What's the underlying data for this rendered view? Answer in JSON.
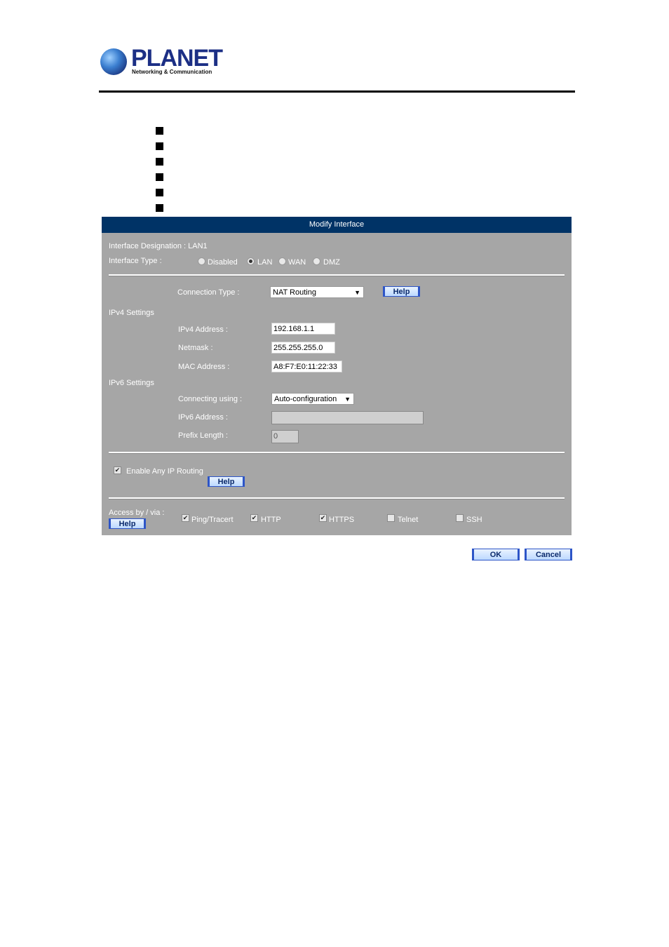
{
  "logo": {
    "brand": "PLANET",
    "tagline": "Networking & Communication"
  },
  "bullets_count": 6,
  "panel": {
    "title": "Modify Interface",
    "interface_designation_label": "Interface Designation : LAN1",
    "interface_type_label": "Interface Type :",
    "interface_type_options": [
      {
        "label": "Disabled",
        "selected": false
      },
      {
        "label": "LAN",
        "selected": true
      },
      {
        "label": "WAN",
        "selected": false
      },
      {
        "label": "DMZ",
        "selected": false
      }
    ],
    "connection_type_label": "Connection Type :",
    "connection_type_value": "NAT Routing",
    "help_label": "Help",
    "ipv4_section": "IPv4 Settings",
    "ipv4_address_label": "IPv4 Address :",
    "ipv4_address_value": "192.168.1.1",
    "netmask_label": "Netmask :",
    "netmask_value": "255.255.255.0",
    "mac_label": "MAC Address :",
    "mac_value": "A8:F7:E0:11:22:33",
    "ipv6_section": "IPv6 Settings",
    "connecting_using_label": "Connecting using :",
    "connecting_using_value": "Auto-configuration",
    "ipv6_address_label": "IPv6 Address :",
    "ipv6_address_value": "",
    "prefix_length_label": "Prefix Length :",
    "prefix_length_value": "0",
    "any_ip_routing_label": "Enable Any IP Routing",
    "any_ip_routing_checked": true,
    "access_label": "Access by / via :",
    "access_options": [
      {
        "label": "Ping/Tracert",
        "checked": true
      },
      {
        "label": "HTTP",
        "checked": true
      },
      {
        "label": "HTTPS",
        "checked": true
      },
      {
        "label": "Telnet",
        "checked": false
      },
      {
        "label": "SSH",
        "checked": false
      }
    ]
  },
  "footer": {
    "ok_label": "OK",
    "cancel_label": "Cancel"
  },
  "colors": {
    "header_bg": "#003366",
    "panel_bg": "#a6a6a6",
    "button_border": "#2d55c7"
  }
}
